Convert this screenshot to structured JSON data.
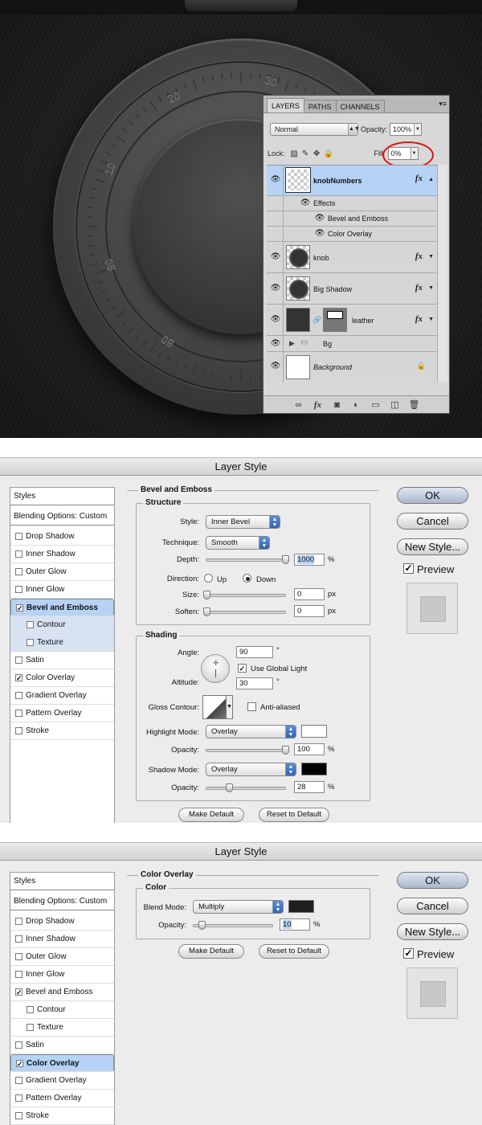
{
  "scene": {
    "dial_numbers": [
      "30",
      "20",
      "10",
      "90",
      "80"
    ],
    "layers_panel": {
      "tabs": [
        "LAYERS",
        "PATHS",
        "CHANNELS"
      ],
      "menu_icon": "panel-menu-icon",
      "blend_mode": "Normal",
      "opacity_label": "Opacity:",
      "opacity_value": "100%",
      "lock_label": "Lock:",
      "fill_label": "Fill:",
      "fill_value": "0%",
      "layers": [
        {
          "name": "knobNumbers",
          "selected": true,
          "has_fx": true
        },
        {
          "name": "Effects"
        },
        {
          "name": "Bevel and Emboss"
        },
        {
          "name": "Color Overlay"
        },
        {
          "name": "knob",
          "has_fx": true
        },
        {
          "name": "Big Shadow",
          "has_fx": true
        },
        {
          "name": "leather",
          "has_fx": true
        },
        {
          "name": "Bg",
          "type": "group"
        },
        {
          "name": "Background",
          "locked": true
        }
      ],
      "fx_label": "fx"
    }
  },
  "dialog1": {
    "title": "Layer Style",
    "styles_header": "Styles",
    "blending_options": "Blending Options: Custom",
    "items": [
      {
        "label": "Drop Shadow",
        "checked": false
      },
      {
        "label": "Inner Shadow",
        "checked": false
      },
      {
        "label": "Outer Glow",
        "checked": false
      },
      {
        "label": "Inner Glow",
        "checked": false
      },
      {
        "label": "Bevel and Emboss",
        "checked": true
      },
      {
        "label": "Contour",
        "checked": false
      },
      {
        "label": "Texture",
        "checked": false
      },
      {
        "label": "Satin",
        "checked": false
      },
      {
        "label": "Color Overlay",
        "checked": true
      },
      {
        "label": "Gradient Overlay",
        "checked": false
      },
      {
        "label": "Pattern Overlay",
        "checked": false
      },
      {
        "label": "Stroke",
        "checked": false
      }
    ],
    "section_title": "Bevel and Emboss",
    "structure": {
      "legend": "Structure",
      "style_label": "Style:",
      "style_value": "Inner Bevel",
      "technique_label": "Technique:",
      "technique_value": "Smooth",
      "depth_label": "Depth:",
      "depth_value": "1000",
      "depth_unit": "%",
      "depth_fraction": 1.0,
      "direction_label": "Direction:",
      "up_label": "Up",
      "down_label": "Down",
      "size_label": "Size:",
      "size_value": "0",
      "size_unit": "px",
      "soften_label": "Soften:",
      "soften_value": "0",
      "soften_unit": "px"
    },
    "shading": {
      "legend": "Shading",
      "angle_label": "Angle:",
      "angle_value": "90",
      "angle_unit": "°",
      "global_light_label": "Use Global Light",
      "altitude_label": "Altitude:",
      "altitude_value": "30",
      "altitude_unit": "°",
      "gloss_label": "Gloss Contour:",
      "anti_aliased_label": "Anti-aliased",
      "highlight_mode_label": "Highlight Mode:",
      "highlight_mode_value": "Overlay",
      "highlight_color": "#ffffff",
      "hl_opacity_label": "Opacity:",
      "hl_opacity_value": "100",
      "hl_opacity_unit": "%",
      "shadow_mode_label": "Shadow Mode:",
      "shadow_mode_value": "Overlay",
      "shadow_color": "#000000",
      "sh_opacity_label": "Opacity:",
      "sh_opacity_value": "28",
      "sh_opacity_unit": "%"
    },
    "make_default": "Make Default",
    "reset_default": "Reset to Default",
    "ok": "OK",
    "cancel": "Cancel",
    "new_style": "New Style...",
    "preview": "Preview"
  },
  "dialog2": {
    "title": "Layer Style",
    "styles_header": "Styles",
    "blending_options": "Blending Options: Custom",
    "section_title": "Color Overlay",
    "color_legend": "Color",
    "blend_mode_label": "Blend Mode:",
    "blend_mode_value": "Multiply",
    "overlay_color": "#1f1f1f",
    "opacity_label": "Opacity:",
    "opacity_value": "10",
    "opacity_unit": "%",
    "make_default": "Make Default",
    "reset_default": "Reset to Default",
    "ok": "OK",
    "cancel": "Cancel",
    "new_style": "New Style...",
    "preview": "Preview"
  }
}
